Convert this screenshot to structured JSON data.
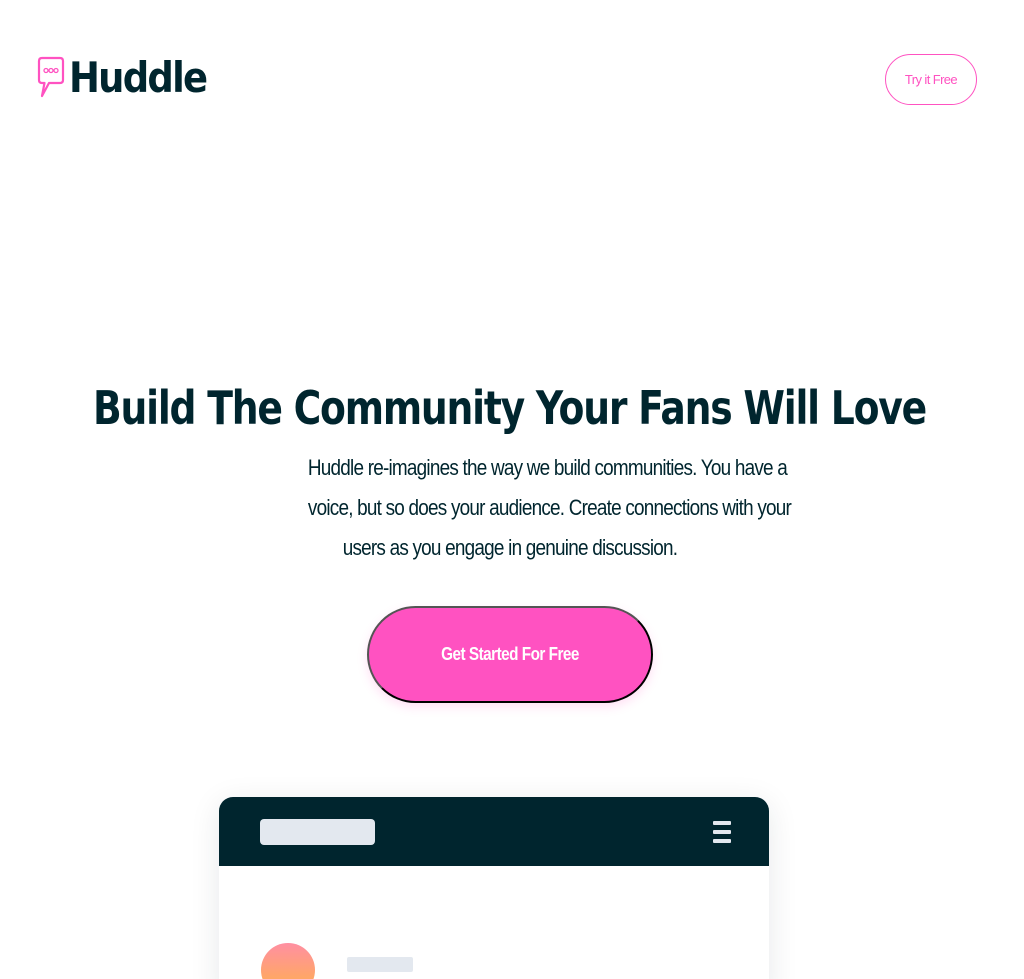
{
  "brand": {
    "name": "Huddle",
    "logo_icon": "speech-bubble-icon",
    "accent_color": "#ff52c1",
    "dark_color": "#00252e"
  },
  "header": {
    "try_label": "Try it Free"
  },
  "hero": {
    "title": "Build The Community Your Fans Will Love",
    "description_lines": [
      "Huddle re-imagines the way we build communities. You have a",
      "voice, but so does your audience. Create connections with your",
      "users as you engage in genuine discussion."
    ],
    "cta_label": "Get Started For Free"
  },
  "mockup": {
    "menu_icon": "hamburger-menu-icon"
  }
}
